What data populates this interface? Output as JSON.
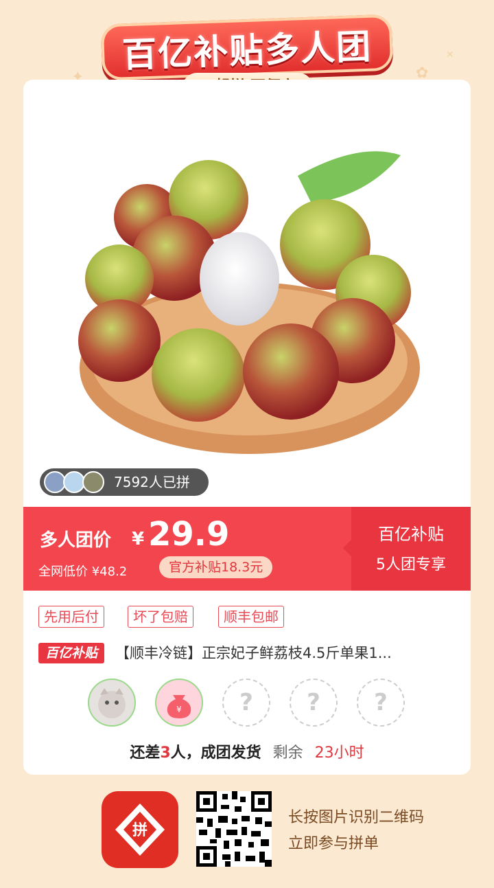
{
  "banner": {
    "title": "百亿补贴多人团",
    "subtitle": "一起拼 更便宜"
  },
  "group": {
    "count_text": "7592人已拼"
  },
  "price": {
    "label": "多人团价",
    "currency": "¥",
    "value": "29.9",
    "low_price_text": "全网低价 ¥48.2",
    "subsidy_text": "官方补贴18.3元",
    "right_line1": "百亿补贴",
    "right_line2": "5人团专享"
  },
  "tags": [
    "先用后付",
    "坏了包赔",
    "顺丰包邮"
  ],
  "product": {
    "badge": "百亿补贴",
    "title": "【顺丰冷链】正宗妃子鲜荔枝4.5斤单果1..."
  },
  "slots": {
    "empty_mark": "?"
  },
  "remain": {
    "prefix": "还差",
    "count": "3",
    "suffix": "人，成团发货",
    "remain_label": "剩余",
    "remain_time": "23小时"
  },
  "footer": {
    "logo_text": "拼",
    "line1": "长按图片识别二维码",
    "line2": "立即参与拼单"
  },
  "colors": {
    "brand_red": "#e83540",
    "price_bar": "#f2454e",
    "background": "#fbe9d2"
  }
}
